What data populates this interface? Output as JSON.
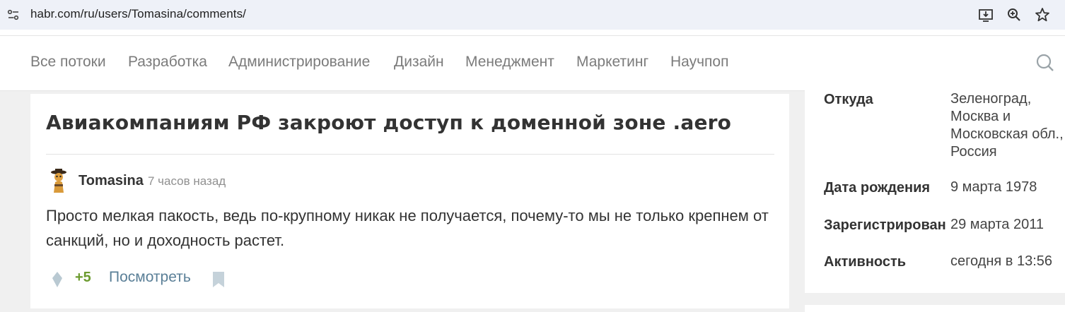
{
  "browser": {
    "url": "habr.com/ru/users/Tomasina/comments/"
  },
  "nav": {
    "items": [
      "Все потоки",
      "Разработка",
      "Администрирование",
      "Дизайн",
      "Менеджмент",
      "Маркетинг",
      "Научпоп"
    ]
  },
  "comment": {
    "article_title": "Авиакомпаниям РФ закроют доступ к доменной зоне .aero",
    "author": "Tomasina",
    "time_ago": "7 часов назад",
    "text": "Просто мелкая пакость, ведь по-крупному никак не получается, почему-то мы не только крепнем от санкций, но и доходность растет.",
    "score": "+5",
    "view_label": "Посмотреть"
  },
  "profile": {
    "from_label": "Откуда",
    "from_value": [
      "Зеленоград,",
      "Москва и",
      "Московская обл.,",
      "Россия"
    ],
    "birth_label": "Дата рождения",
    "birth_value": "9 марта 1978",
    "registered_label": "Зарегистрирован",
    "registered_value": "29 марта 2011",
    "activity_label": "Активность",
    "activity_value": "сегодня в 13:56"
  },
  "colors": {
    "score": "#6c9b2f",
    "link": "#5a7f97",
    "nav_text": "#7b7b7b"
  }
}
